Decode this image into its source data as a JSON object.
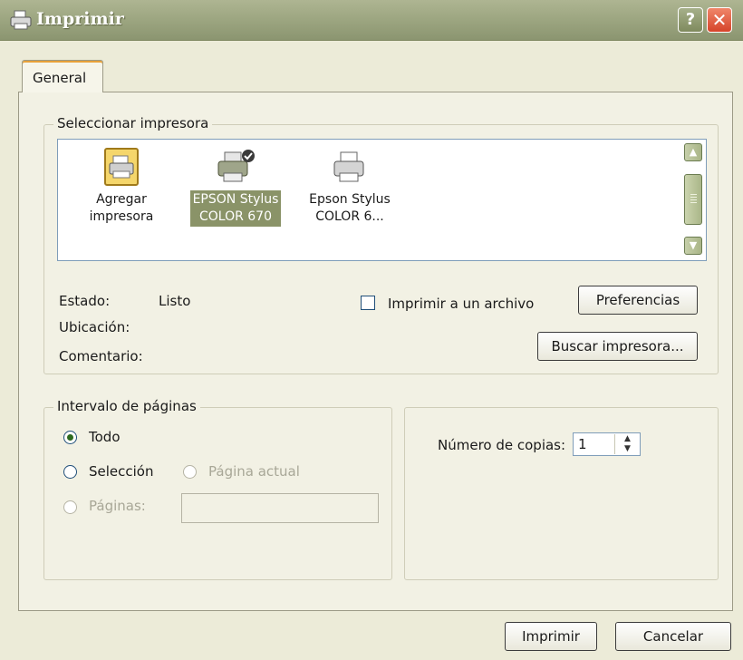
{
  "window": {
    "title": "Imprimir",
    "help_label": "?",
    "close_label": "✕"
  },
  "tabs": [
    {
      "label": "General"
    }
  ],
  "select_printer": {
    "group_label": "Seleccionar impresora",
    "printers": [
      {
        "line1": "Agregar",
        "line2": "impresora",
        "icon": "add-printer-icon",
        "selected": false
      },
      {
        "line1": "EPSON Stylus",
        "line2": "COLOR 670",
        "icon": "printer-default-icon",
        "selected": true
      },
      {
        "line1": "Epson Stylus",
        "line2": "COLOR 6...",
        "icon": "printer-icon",
        "selected": false
      }
    ],
    "status_label": "Estado:",
    "status_value": "Listo",
    "location_label": "Ubicación:",
    "comment_label": "Comentario:",
    "print_to_file_label": "Imprimir a un archivo",
    "print_to_file_checked": false,
    "preferences_label": "Preferencias",
    "find_printer_label": "Buscar impresora..."
  },
  "page_range": {
    "group_label": "Intervalo de páginas",
    "all_label": "Todo",
    "selection_label": "Selección",
    "current_page_label": "Página actual",
    "pages_label": "Páginas:",
    "pages_value": "",
    "selected_option": "all"
  },
  "copies": {
    "label": "Número de copias:",
    "value": "1",
    "up_arrow": "▲",
    "down_arrow": "▼"
  },
  "footer": {
    "print_label": "Imprimir",
    "cancel_label": "Cancelar"
  },
  "colors": {
    "titlebar": "#9ea782",
    "selection": "#8a9368",
    "close_button": "#d6442a",
    "dialog_bg": "#ecebd8"
  }
}
